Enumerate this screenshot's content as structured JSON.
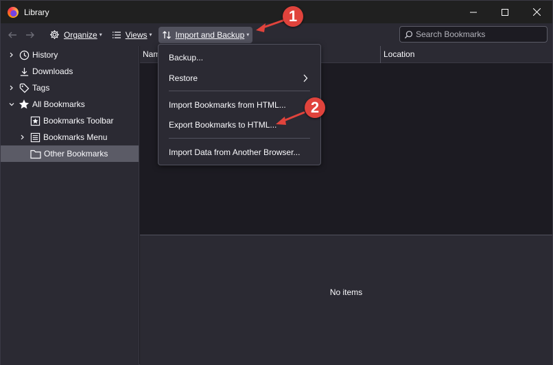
{
  "window": {
    "title": "Library",
    "controls": [
      "minimize",
      "maximize",
      "close"
    ]
  },
  "toolbar": {
    "organize_label": "Organize",
    "views_label": "Views",
    "import_backup_label": "Import and Backup",
    "search_placeholder": "Search Bookmarks"
  },
  "sidebar": {
    "items": [
      {
        "label": "History",
        "icon": "clock-icon",
        "twisty": "collapsed"
      },
      {
        "label": "Downloads",
        "icon": "download-icon",
        "twisty": "none"
      },
      {
        "label": "Tags",
        "icon": "tag-icon",
        "twisty": "collapsed"
      },
      {
        "label": "All Bookmarks",
        "icon": "star-icon",
        "twisty": "expanded"
      },
      {
        "label": "Bookmarks Toolbar",
        "icon": "bookmarks-toolbar-icon",
        "twisty": "none"
      },
      {
        "label": "Bookmarks Menu",
        "icon": "bookmarks-menu-icon",
        "twisty": "collapsed"
      },
      {
        "label": "Other Bookmarks",
        "icon": "folder-icon",
        "twisty": "none",
        "selected": true
      }
    ]
  },
  "columns": {
    "name": "Nam",
    "location": "Location"
  },
  "details": {
    "empty_text": "No items"
  },
  "menu": {
    "items": [
      {
        "label": "Backup...",
        "has_submenu": false
      },
      {
        "label": "Restore",
        "has_submenu": true
      },
      {
        "label": "Import Bookmarks from HTML...",
        "has_submenu": false
      },
      {
        "label": "Export Bookmarks to HTML...",
        "has_submenu": false
      },
      {
        "label": "Import Data from Another Browser...",
        "has_submenu": false
      }
    ]
  },
  "annotations": {
    "step1": "1",
    "step2": "2",
    "color": "#e0433c"
  },
  "colors": {
    "window_bg": "#1c1b22",
    "panel_bg": "#2b2a33",
    "titlebar_bg": "#202020",
    "selection_bg": "#5b5b66"
  }
}
